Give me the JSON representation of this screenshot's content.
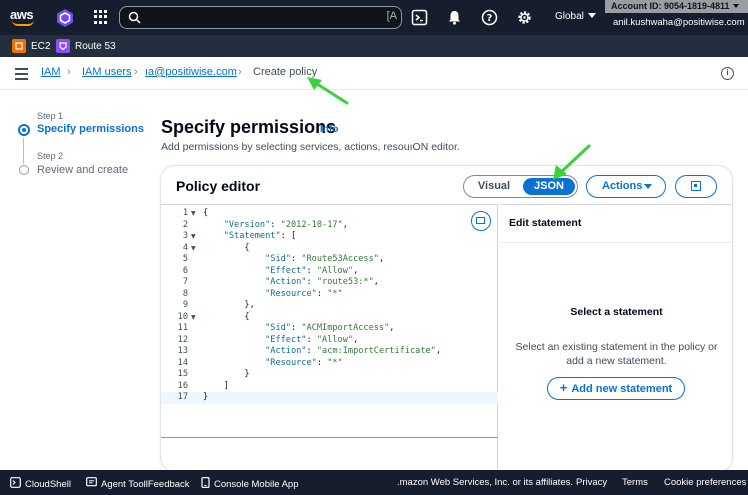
{
  "topnav": {
    "logo_text": "aws",
    "search": {
      "placeholder": "",
      "shortcut": "[A"
    },
    "region": "Global",
    "account_label": "Account ID: 9054-1819-4811",
    "user_email": "anil.kushwaha@positiwise.com"
  },
  "favorites": [
    {
      "label": "EC2",
      "color": "#ed7100"
    },
    {
      "label": "Route 53",
      "color": "#8c4fff"
    }
  ],
  "breadcrumb": {
    "items": [
      "IAM",
      "IAM users",
      "ıa@positiwise.com"
    ],
    "current": "Create policy"
  },
  "steps": [
    {
      "step_label": "Step 1",
      "name": "Specify permissions",
      "active": true
    },
    {
      "step_label": "Step 2",
      "name": "Review and create",
      "active": false
    }
  ],
  "main": {
    "title": "Specify permissions",
    "info": "Info",
    "description": "Add permissions by selecting services, actions, resouıON editor."
  },
  "editor": {
    "title": "Policy editor",
    "tabs": {
      "visual": "Visual",
      "json": "JSON",
      "selected": "JSON"
    },
    "actions_label": "Actions",
    "code_lines": [
      {
        "n": "1",
        "fold": "▼",
        "text": "{"
      },
      {
        "n": "2",
        "fold": "",
        "text": "    \"Version\": \"2012-10-17\","
      },
      {
        "n": "3",
        "fold": "▼",
        "text": "    \"Statement\": ["
      },
      {
        "n": "4",
        "fold": "▼",
        "text": "        {"
      },
      {
        "n": "5",
        "fold": "",
        "text": "            \"Sid\": \"Route53Access\","
      },
      {
        "n": "6",
        "fold": "",
        "text": "            \"Effect\": \"Allow\","
      },
      {
        "n": "7",
        "fold": "",
        "text": "            \"Action\": \"route53:*\","
      },
      {
        "n": "8",
        "fold": "",
        "text": "            \"Resource\": \"*\""
      },
      {
        "n": "9",
        "fold": "",
        "text": "        },"
      },
      {
        "n": "10",
        "fold": "▼",
        "text": "        {"
      },
      {
        "n": "11",
        "fold": "",
        "text": "            \"Sid\": \"ACMImportAccess\","
      },
      {
        "n": "12",
        "fold": "",
        "text": "            \"Effect\": \"Allow\","
      },
      {
        "n": "13",
        "fold": "",
        "text": "            \"Action\": \"acm:ImportCertificate\","
      },
      {
        "n": "14",
        "fold": "",
        "text": "            \"Resource\": \"*\""
      },
      {
        "n": "15",
        "fold": "",
        "text": "        }"
      },
      {
        "n": "16",
        "fold": "",
        "text": "    ]"
      },
      {
        "n": "17",
        "fold": "",
        "text": "}"
      }
    ],
    "side_panel": {
      "header": "Edit statement",
      "title": "Select a statement",
      "description": "Select an existing statement in the policy or add a new statement.",
      "add_label": "Add new statement"
    }
  },
  "footer": {
    "cloudshell": "CloudShell",
    "agent": "Agent ToollFeedback",
    "mobile": "Console Mobile App",
    "copyright": ".mazon Web Services, Inc. or its affiliates.",
    "privacy": "Privacy",
    "terms": "Terms",
    "cookies": "Cookie preferences"
  },
  "colors": {
    "accent": "#0972d3",
    "nav_bg": "#161e2d",
    "annotation_arrow": "#3ad23a"
  }
}
